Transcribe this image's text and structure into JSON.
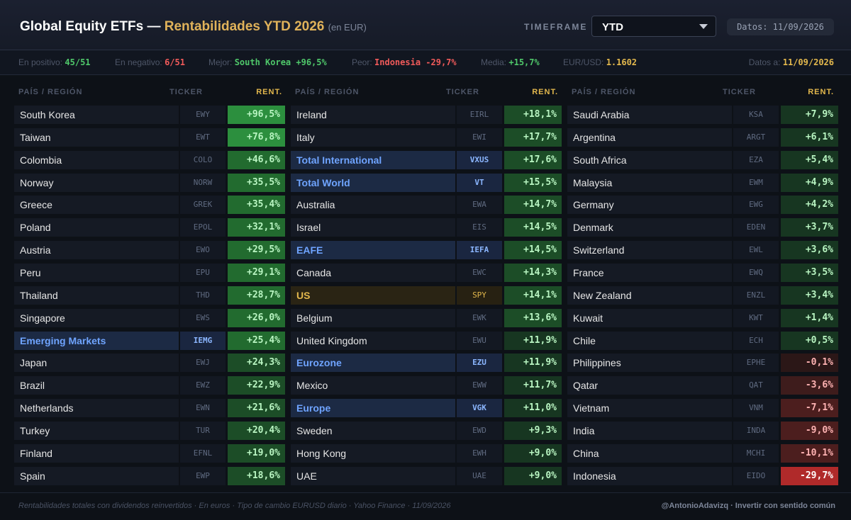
{
  "header": {
    "title_main": "Global Equity ETFs —",
    "title_accent": "Rentabilidades YTD 2026",
    "title_currency": "(en EUR)",
    "timeframe_label": "TIMEFRAME",
    "timeframe_value": "YTD",
    "date_badge": "Datos: 11/09/2026"
  },
  "stats": {
    "positive_label": "En positivo:",
    "positive_value": "45/51",
    "negative_label": "En negativo:",
    "negative_value": "6/51",
    "best_label": "Mejor:",
    "best_value": "South Korea +96,5%",
    "worst_label": "Peor:",
    "worst_value": "Indonesia -29,7%",
    "mean_label": "Media:",
    "mean_value": "+15,7%",
    "fx_label": "EUR/USD:",
    "fx_value": "1.1602",
    "date_label": "Datos a:",
    "date_value": "11/09/2026"
  },
  "columns": {
    "region": "PAÍS / REGIÓN",
    "ticker": "TICKER",
    "rent": "RENT."
  },
  "rows": [
    {
      "name": "South Korea",
      "ticker": "EWY",
      "value": "+96,5%",
      "num": 96.5,
      "hl": ""
    },
    {
      "name": "Taiwan",
      "ticker": "EWT",
      "value": "+76,8%",
      "num": 76.8,
      "hl": ""
    },
    {
      "name": "Colombia",
      "ticker": "COLO",
      "value": "+46,6%",
      "num": 46.6,
      "hl": ""
    },
    {
      "name": "Norway",
      "ticker": "NORW",
      "value": "+35,5%",
      "num": 35.5,
      "hl": ""
    },
    {
      "name": "Greece",
      "ticker": "GREK",
      "value": "+35,4%",
      "num": 35.4,
      "hl": ""
    },
    {
      "name": "Poland",
      "ticker": "EPOL",
      "value": "+32,1%",
      "num": 32.1,
      "hl": ""
    },
    {
      "name": "Austria",
      "ticker": "EWO",
      "value": "+29,5%",
      "num": 29.5,
      "hl": ""
    },
    {
      "name": "Peru",
      "ticker": "EPU",
      "value": "+29,1%",
      "num": 29.1,
      "hl": ""
    },
    {
      "name": "Thailand",
      "ticker": "THD",
      "value": "+28,7%",
      "num": 28.7,
      "hl": ""
    },
    {
      "name": "Singapore",
      "ticker": "EWS",
      "value": "+26,0%",
      "num": 26.0,
      "hl": ""
    },
    {
      "name": "Emerging Markets",
      "ticker": "IEMG",
      "value": "+25,4%",
      "num": 25.4,
      "hl": "blue"
    },
    {
      "name": "Japan",
      "ticker": "EWJ",
      "value": "+24,3%",
      "num": 24.3,
      "hl": ""
    },
    {
      "name": "Brazil",
      "ticker": "EWZ",
      "value": "+22,9%",
      "num": 22.9,
      "hl": ""
    },
    {
      "name": "Netherlands",
      "ticker": "EWN",
      "value": "+21,6%",
      "num": 21.6,
      "hl": ""
    },
    {
      "name": "Turkey",
      "ticker": "TUR",
      "value": "+20,4%",
      "num": 20.4,
      "hl": ""
    },
    {
      "name": "Finland",
      "ticker": "EFNL",
      "value": "+19,0%",
      "num": 19.0,
      "hl": ""
    },
    {
      "name": "Spain",
      "ticker": "EWP",
      "value": "+18,6%",
      "num": 18.6,
      "hl": ""
    },
    {
      "name": "Ireland",
      "ticker": "EIRL",
      "value": "+18,1%",
      "num": 18.1,
      "hl": ""
    },
    {
      "name": "Italy",
      "ticker": "EWI",
      "value": "+17,7%",
      "num": 17.7,
      "hl": ""
    },
    {
      "name": "Total International",
      "ticker": "VXUS",
      "value": "+17,6%",
      "num": 17.6,
      "hl": "blue"
    },
    {
      "name": "Total World",
      "ticker": "VT",
      "value": "+15,5%",
      "num": 15.5,
      "hl": "blue"
    },
    {
      "name": "Australia",
      "ticker": "EWA",
      "value": "+14,7%",
      "num": 14.7,
      "hl": ""
    },
    {
      "name": "Israel",
      "ticker": "EIS",
      "value": "+14,5%",
      "num": 14.5,
      "hl": ""
    },
    {
      "name": "EAFE",
      "ticker": "IEFA",
      "value": "+14,5%",
      "num": 14.5,
      "hl": "blue"
    },
    {
      "name": "Canada",
      "ticker": "EWC",
      "value": "+14,3%",
      "num": 14.3,
      "hl": ""
    },
    {
      "name": "US",
      "ticker": "SPY",
      "value": "+14,1%",
      "num": 14.1,
      "hl": "gold"
    },
    {
      "name": "Belgium",
      "ticker": "EWK",
      "value": "+13,6%",
      "num": 13.6,
      "hl": ""
    },
    {
      "name": "United Kingdom",
      "ticker": "EWU",
      "value": "+11,9%",
      "num": 11.9,
      "hl": ""
    },
    {
      "name": "Eurozone",
      "ticker": "EZU",
      "value": "+11,9%",
      "num": 11.9,
      "hl": "blue"
    },
    {
      "name": "Mexico",
      "ticker": "EWW",
      "value": "+11,7%",
      "num": 11.7,
      "hl": ""
    },
    {
      "name": "Europe",
      "ticker": "VGK",
      "value": "+11,0%",
      "num": 11.0,
      "hl": "blue"
    },
    {
      "name": "Sweden",
      "ticker": "EWD",
      "value": "+9,3%",
      "num": 9.3,
      "hl": ""
    },
    {
      "name": "Hong Kong",
      "ticker": "EWH",
      "value": "+9,0%",
      "num": 9.0,
      "hl": ""
    },
    {
      "name": "UAE",
      "ticker": "UAE",
      "value": "+9,0%",
      "num": 9.0,
      "hl": ""
    },
    {
      "name": "Saudi Arabia",
      "ticker": "KSA",
      "value": "+7,9%",
      "num": 7.9,
      "hl": ""
    },
    {
      "name": "Argentina",
      "ticker": "ARGT",
      "value": "+6,1%",
      "num": 6.1,
      "hl": ""
    },
    {
      "name": "South Africa",
      "ticker": "EZA",
      "value": "+5,4%",
      "num": 5.4,
      "hl": ""
    },
    {
      "name": "Malaysia",
      "ticker": "EWM",
      "value": "+4,9%",
      "num": 4.9,
      "hl": ""
    },
    {
      "name": "Germany",
      "ticker": "EWG",
      "value": "+4,2%",
      "num": 4.2,
      "hl": ""
    },
    {
      "name": "Denmark",
      "ticker": "EDEN",
      "value": "+3,7%",
      "num": 3.7,
      "hl": ""
    },
    {
      "name": "Switzerland",
      "ticker": "EWL",
      "value": "+3,6%",
      "num": 3.6,
      "hl": ""
    },
    {
      "name": "France",
      "ticker": "EWQ",
      "value": "+3,5%",
      "num": 3.5,
      "hl": ""
    },
    {
      "name": "New Zealand",
      "ticker": "ENZL",
      "value": "+3,4%",
      "num": 3.4,
      "hl": ""
    },
    {
      "name": "Kuwait",
      "ticker": "KWT",
      "value": "+1,4%",
      "num": 1.4,
      "hl": ""
    },
    {
      "name": "Chile",
      "ticker": "ECH",
      "value": "+0,5%",
      "num": 0.5,
      "hl": ""
    },
    {
      "name": "Philippines",
      "ticker": "EPHE",
      "value": "-0,1%",
      "num": -0.1,
      "hl": ""
    },
    {
      "name": "Qatar",
      "ticker": "QAT",
      "value": "-3,6%",
      "num": -3.6,
      "hl": ""
    },
    {
      "name": "Vietnam",
      "ticker": "VNM",
      "value": "-7,1%",
      "num": -7.1,
      "hl": ""
    },
    {
      "name": "India",
      "ticker": "INDA",
      "value": "-9,0%",
      "num": -9.0,
      "hl": ""
    },
    {
      "name": "China",
      "ticker": "MCHI",
      "value": "-10,1%",
      "num": -10.1,
      "hl": ""
    },
    {
      "name": "Indonesia",
      "ticker": "EIDO",
      "value": "-29,7%",
      "num": -29.7,
      "hl": ""
    }
  ],
  "footer": {
    "note": "Rentabilidades totales con dividendos reinvertidos · En euros · Tipo de cambio EURUSD diario · Yahoo Finance · 11/09/2026",
    "brand": "@AntonioAdavizq · Invertir con sentido común"
  },
  "colors": {
    "accent_gold": "#e3b84d",
    "positive": "#4fc76a",
    "negative": "#f05a5a",
    "highlight_blue": "#6fa4ff"
  }
}
